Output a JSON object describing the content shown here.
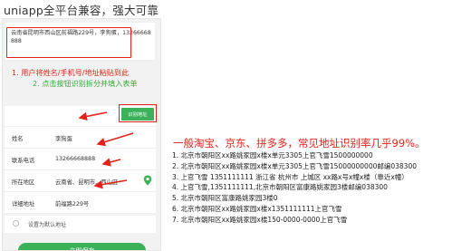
{
  "page": {
    "heading": "uniapp全平台兼容，强大可靠"
  },
  "input_area": {
    "text": "云南省昆明市西山区前福路229号，李狗蛋，13266668888"
  },
  "tips": {
    "step1": "1. 用户将姓名/手机号/地址粘贴到此",
    "step2": "2. 点击按钮识别拆分并填入表单"
  },
  "identify_button": {
    "label": "识别地址"
  },
  "form": {
    "name": {
      "label": "姓名",
      "value": "李狗蛋"
    },
    "phone": {
      "label": "联系电话",
      "value": "13266668888"
    },
    "region": {
      "label": "所在地区",
      "value": "云南省、昆明市、西山区"
    },
    "address": {
      "label": "详细地址",
      "value": "前福路229号"
    }
  },
  "default_option": {
    "label": "设置为默认地址",
    "checked": false
  },
  "save_button": {
    "label": "立即保存"
  },
  "headline": "一般淘宝、京东、拼多多，常见地址识别率几乎99%。",
  "examples": [
    "1. 北京市朝阳区xx路姚家园x楼x单元3305上官飞雪1500000000",
    "2. 北京市朝阳区xx路姚家园x楼x单元3305上官飞雪15000000000邮编038300",
    "3. 上官飞雪 1351111111 浙江省 杭州市 上城区 xx路x号x幢x楼（靠近x幢）",
    "4. 上官飞雪,1351111111,北京市朝阳区富康路姚家园3楼邮编038300",
    "5. 北京市朝阳区富康路姚家园3楼0",
    "6. 北京市朝阳区xx路姚家园x楼x1351111111上官飞雪",
    "7. 北京市朝阳区xx路姚家园x楼150-0000-0000上官飞雪"
  ],
  "colors": {
    "accent_red": "#e2231a",
    "accent_green": "#3db15a",
    "background": "#f2f2f2"
  },
  "icons": {
    "location": "location-pin-icon"
  }
}
